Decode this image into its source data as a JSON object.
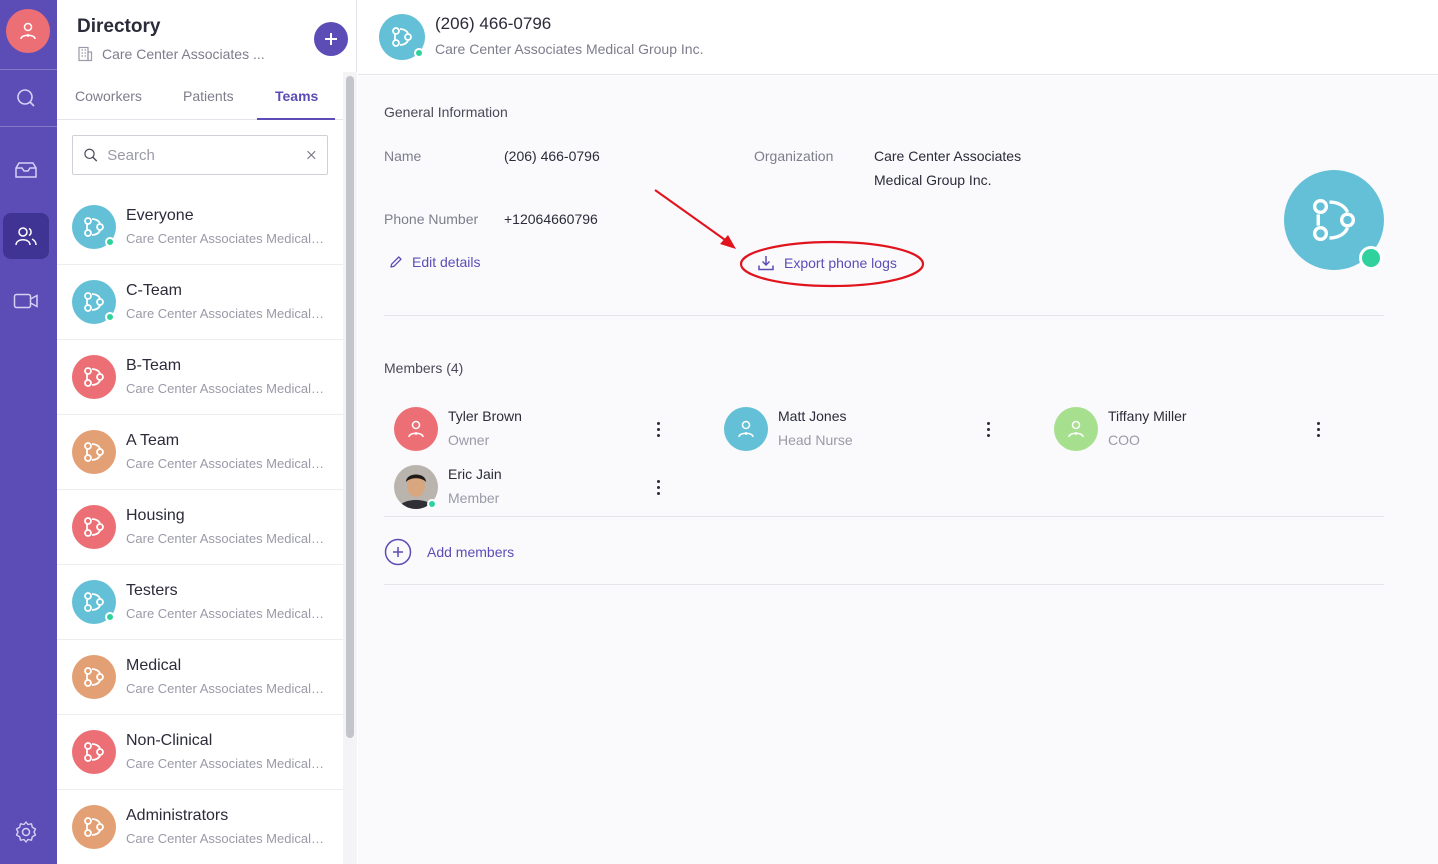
{
  "colors": {
    "brand": "#5b4db5",
    "rail_active": "#3f3494",
    "online": "#2fd29c",
    "team_blue": "#63c0d6",
    "team_red": "#ec6f75",
    "team_orange": "#e3a074",
    "member_green": "#a6df8e",
    "annotation_red": "#e1141e"
  },
  "rail": {
    "items": [
      {
        "icon": "search-icon"
      },
      {
        "icon": "inbox-icon"
      },
      {
        "icon": "users-icon",
        "active": true
      },
      {
        "icon": "video-icon"
      },
      {
        "icon": "settings-icon"
      }
    ]
  },
  "sidebar": {
    "title": "Directory",
    "org": "Care Center Associates ...",
    "tabs": [
      {
        "label": "Coworkers"
      },
      {
        "label": "Patients"
      },
      {
        "label": "Teams",
        "active": true
      }
    ],
    "search_placeholder": "Search",
    "teams": [
      {
        "name": "Everyone",
        "sub": "Care Center Associates Medical Group Inc.",
        "color": "blue",
        "online": true
      },
      {
        "name": "C-Team",
        "sub": "Care Center Associates Medical Group Inc.",
        "color": "blue",
        "online": true
      },
      {
        "name": "B-Team",
        "sub": "Care Center Associates Medical Group Inc.",
        "color": "red",
        "online": false
      },
      {
        "name": "A Team",
        "sub": "Care Center Associates Medical Group Inc.",
        "color": "orange",
        "online": false
      },
      {
        "name": "Housing",
        "sub": "Care Center Associates Medical Group Inc.",
        "color": "red",
        "online": false
      },
      {
        "name": "Testers",
        "sub": "Care Center Associates Medical Group Inc.",
        "color": "blue",
        "online": true
      },
      {
        "name": "Medical",
        "sub": "Care Center Associates Medical Group Inc.",
        "color": "orange",
        "online": false
      },
      {
        "name": "Non-Clinical",
        "sub": "Care Center Associates Medical Group Inc.",
        "color": "red",
        "online": false
      },
      {
        "name": "Administrators",
        "sub": "Care Center Associates Medical Group Inc.",
        "color": "orange",
        "online": false
      }
    ]
  },
  "header": {
    "title": "(206) 466-0796",
    "subtitle": "Care Center Associates Medical Group Inc."
  },
  "general": {
    "section_title": "General Information",
    "name_label": "Name",
    "name_value": "(206) 466-0796",
    "org_label": "Organization",
    "org_value_line1": "Care Center Associates",
    "org_value_line2": "Medical Group Inc.",
    "phone_label": "Phone Number",
    "phone_value": "+12064660796",
    "edit_label": "Edit details",
    "export_label": "Export phone logs"
  },
  "members": {
    "title": "Members (4)",
    "list": [
      {
        "name": "Tyler Brown",
        "role": "Owner",
        "avatar": "red"
      },
      {
        "name": "Matt Jones",
        "role": "Head Nurse",
        "avatar": "blue"
      },
      {
        "name": "Tiffany Miller",
        "role": "COO",
        "avatar": "green"
      },
      {
        "name": "Eric Jain",
        "role": "Member",
        "avatar": "photo",
        "online": true
      }
    ],
    "add_label": "Add members"
  }
}
